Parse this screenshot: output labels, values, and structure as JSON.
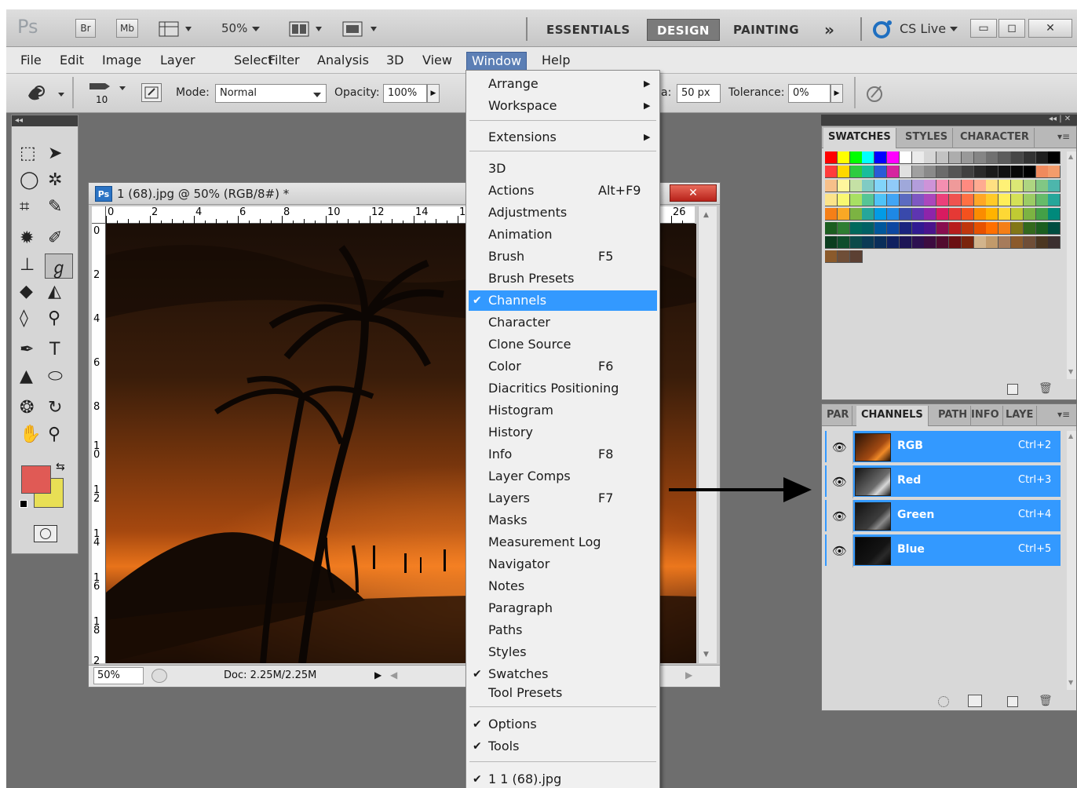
{
  "appbar": {
    "bridge_label": "Br",
    "minibridge_label": "Mb",
    "zoom": "50%",
    "workspaces": [
      "ESSENTIALS",
      "DESIGN",
      "PAINTING"
    ],
    "more": "»",
    "cslive": "CS Live",
    "win_min": "▭",
    "win_max": "◻",
    "win_close": "✕"
  },
  "menubar": {
    "items": [
      "File",
      "Edit",
      "Image",
      "Layer",
      "Select",
      "Filter",
      "Analysis",
      "3D",
      "View",
      "Window",
      "Help"
    ],
    "open_item": "Window"
  },
  "options": {
    "brush_size": "10",
    "mode_label": "Mode:",
    "mode_value": "Normal",
    "opacity_label": "Opacity:",
    "opacity_value": "100%",
    "spacing_label": "a:",
    "spacing_value": "50 px",
    "tolerance_label": "Tolerance:",
    "tolerance_value": "0%"
  },
  "tools": {
    "fg_color": "#e05a55",
    "bg_color": "#e8df55"
  },
  "document": {
    "badge": "Ps",
    "title": "1 (68).jpg @ 50% (RGB/8#) *",
    "close": "✕",
    "h_ticks": [
      "0",
      "2",
      "4",
      "6",
      "8",
      "10",
      "12",
      "14",
      "1",
      "26"
    ],
    "v_ticks": [
      "0",
      "2",
      "4",
      "6",
      "8",
      "1\n0",
      "1\n2",
      "1\n4",
      "1\n6",
      "1\n8",
      "2"
    ],
    "status_zoom": "50%",
    "status_doc": "Doc: 2.25M/2.25M"
  },
  "window_menu": {
    "items": [
      {
        "label": "Arrange",
        "shortcut": "",
        "submenu": true,
        "checked": false
      },
      {
        "label": "Workspace",
        "shortcut": "",
        "submenu": true,
        "checked": false
      },
      {
        "label": "Extensions",
        "shortcut": "",
        "submenu": true,
        "checked": false
      },
      {
        "label": "3D",
        "shortcut": "",
        "submenu": false,
        "checked": false
      },
      {
        "label": "Actions",
        "shortcut": "Alt+F9",
        "submenu": false,
        "checked": false
      },
      {
        "label": "Adjustments",
        "shortcut": "",
        "submenu": false,
        "checked": false
      },
      {
        "label": "Animation",
        "shortcut": "",
        "submenu": false,
        "checked": false
      },
      {
        "label": "Brush",
        "shortcut": "F5",
        "submenu": false,
        "checked": false
      },
      {
        "label": "Brush Presets",
        "shortcut": "",
        "submenu": false,
        "checked": false
      },
      {
        "label": "Channels",
        "shortcut": "",
        "submenu": false,
        "checked": true,
        "highlighted": true
      },
      {
        "label": "Character",
        "shortcut": "",
        "submenu": false,
        "checked": false
      },
      {
        "label": "Clone Source",
        "shortcut": "",
        "submenu": false,
        "checked": false
      },
      {
        "label": "Color",
        "shortcut": "F6",
        "submenu": false,
        "checked": false
      },
      {
        "label": "Diacritics Positioning",
        "shortcut": "",
        "submenu": false,
        "checked": false
      },
      {
        "label": "Histogram",
        "shortcut": "",
        "submenu": false,
        "checked": false
      },
      {
        "label": "History",
        "shortcut": "",
        "submenu": false,
        "checked": false
      },
      {
        "label": "Info",
        "shortcut": "F8",
        "submenu": false,
        "checked": false
      },
      {
        "label": "Layer Comps",
        "shortcut": "",
        "submenu": false,
        "checked": false
      },
      {
        "label": "Layers",
        "shortcut": "F7",
        "submenu": false,
        "checked": false
      },
      {
        "label": "Masks",
        "shortcut": "",
        "submenu": false,
        "checked": false
      },
      {
        "label": "Measurement Log",
        "shortcut": "",
        "submenu": false,
        "checked": false
      },
      {
        "label": "Navigator",
        "shortcut": "",
        "submenu": false,
        "checked": false
      },
      {
        "label": "Notes",
        "shortcut": "",
        "submenu": false,
        "checked": false
      },
      {
        "label": "Paragraph",
        "shortcut": "",
        "submenu": false,
        "checked": false
      },
      {
        "label": "Paths",
        "shortcut": "",
        "submenu": false,
        "checked": false
      },
      {
        "label": "Styles",
        "shortcut": "",
        "submenu": false,
        "checked": false
      },
      {
        "label": "Swatches",
        "shortcut": "",
        "submenu": false,
        "checked": true
      },
      {
        "label": "Tool Presets",
        "shortcut": "",
        "submenu": false,
        "checked": false
      },
      {
        "label": "Options",
        "shortcut": "",
        "submenu": false,
        "checked": true
      },
      {
        "label": "Tools",
        "shortcut": "",
        "submenu": false,
        "checked": true
      },
      {
        "label": "1 1 (68).jpg",
        "shortcut": "",
        "submenu": false,
        "checked": true
      }
    ]
  },
  "swatches_panel": {
    "tabs": [
      "SWATCHES",
      "STYLES",
      "CHARACTER"
    ]
  },
  "channels_panel": {
    "tabs": [
      "PAR",
      "CHANNELS",
      "PATH",
      "INFO",
      "LAYE"
    ],
    "channels": [
      {
        "name": "RGB",
        "shortcut": "Ctrl+2"
      },
      {
        "name": "Red",
        "shortcut": "Ctrl+3"
      },
      {
        "name": "Green",
        "shortcut": "Ctrl+4"
      },
      {
        "name": "Blue",
        "shortcut": "Ctrl+5"
      }
    ]
  },
  "colors": {
    "menu_highlight": "#3399ff",
    "channel_row": "#3399ff",
    "window_bg": "#6e6e6e"
  }
}
